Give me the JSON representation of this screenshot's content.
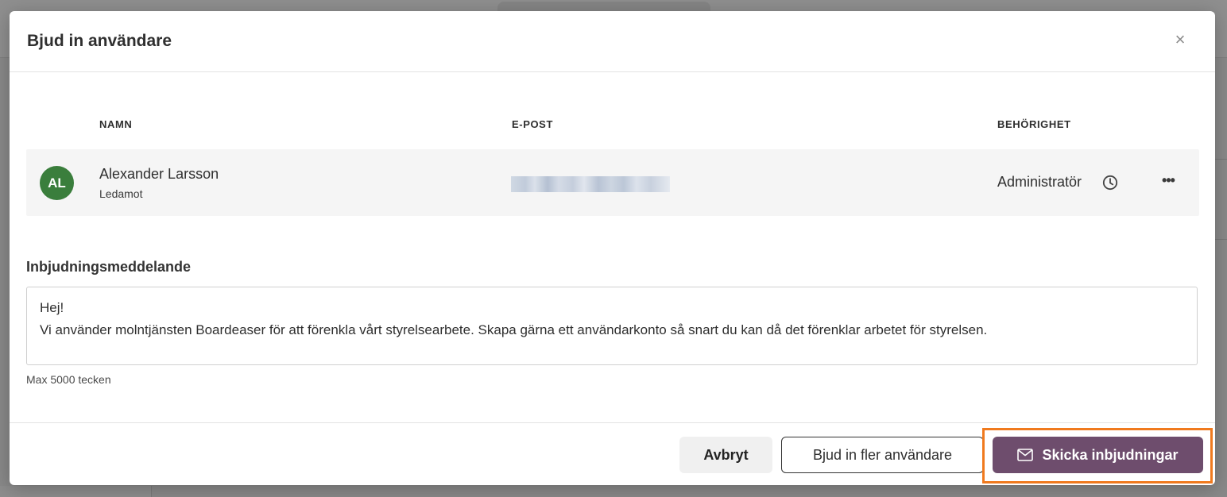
{
  "modal": {
    "title": "Bjud in användare",
    "close_symbol": "×"
  },
  "table": {
    "columns": {
      "name": "NAMN",
      "email": "E-POST",
      "permission": "BEHÖRIGHET"
    },
    "rows": [
      {
        "initials": "AL",
        "name": "Alexander Larsson",
        "role": "Ledamot",
        "permission": "Administratör",
        "avatar_color": "#3a7e3c"
      }
    ],
    "more_symbol": "•••"
  },
  "message": {
    "label": "Inbjudningsmeddelande",
    "line1": "Hej!",
    "line2": "Vi använder molntjänsten Boardeaser för att förenkla vårt styrelsearbete. Skapa gärna ett användarkonto så snart du kan då det förenklar arbetet för styrelsen.",
    "hint": "Max 5000 tecken"
  },
  "footer": {
    "cancel_label": "Avbryt",
    "invite_more_label": "Bjud in fler användare",
    "send_label": "Skicka inbjudningar"
  },
  "colors": {
    "primary": "#6e4d6d",
    "highlight": "#f07a1e"
  }
}
